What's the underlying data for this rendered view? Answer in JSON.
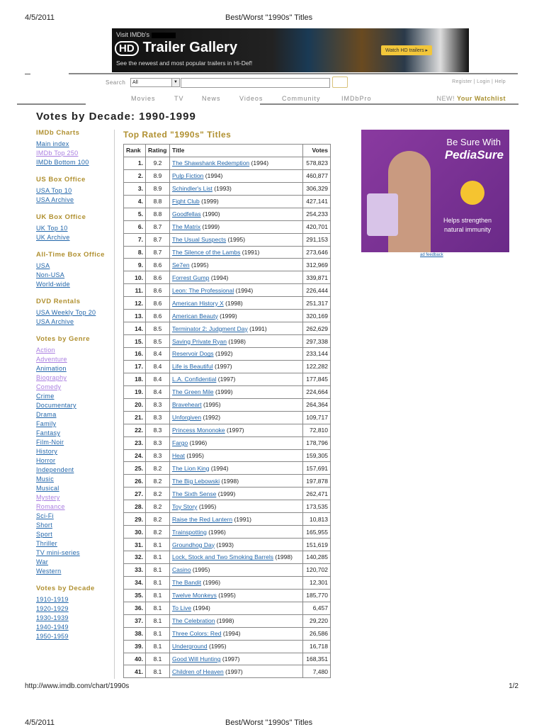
{
  "print_header": {
    "date": "4/5/2011",
    "title": "Best/Worst \"1990s\" Titles"
  },
  "banner": {
    "line1": "Visit IMDb's",
    "hd": "HD",
    "heading": "Trailer Gallery",
    "line3": "See the newest and most popular trailers in Hi-Def!",
    "watch": "Watch HD trailers ▸"
  },
  "search": {
    "label": "Search",
    "select": "All",
    "value": ""
  },
  "account": "Register | Login | Help",
  "nav": [
    "Movies",
    "TV",
    "News",
    "Videos",
    "Community",
    "IMDbPro"
  ],
  "watchlist": {
    "new": "NEW!",
    "label": "Your Watchlist"
  },
  "page_title": "Votes by Decade: 1990-1999",
  "sidebar": [
    {
      "heading": "IMDb Charts",
      "links": [
        {
          "t": "Main index"
        },
        {
          "t": "IMDb Top 250",
          "v": true
        },
        {
          "t": "IMDb Bottom 100"
        }
      ]
    },
    {
      "heading": "US Box Office",
      "links": [
        {
          "t": "USA Top 10"
        },
        {
          "t": "USA Archive"
        }
      ]
    },
    {
      "heading": "UK Box Office",
      "links": [
        {
          "t": "UK Top 10"
        },
        {
          "t": "UK Archive"
        }
      ]
    },
    {
      "heading": "All-Time Box Office",
      "links": [
        {
          "t": "USA"
        },
        {
          "t": "Non-USA"
        },
        {
          "t": "World-wide"
        }
      ]
    },
    {
      "heading": "DVD Rentals",
      "links": [
        {
          "t": "USA Weekly Top 20"
        },
        {
          "t": "USA Archive"
        }
      ]
    },
    {
      "heading": "Votes by Genre",
      "links": [
        {
          "t": "Action",
          "v": true
        },
        {
          "t": "Adventure",
          "v": true
        },
        {
          "t": "Animation"
        },
        {
          "t": "Biography",
          "v": true
        },
        {
          "t": "Comedy",
          "v": true
        },
        {
          "t": "Crime"
        },
        {
          "t": "Documentary"
        },
        {
          "t": "Drama"
        },
        {
          "t": "Family"
        },
        {
          "t": "Fantasy"
        },
        {
          "t": "Film-Noir"
        },
        {
          "t": "History"
        },
        {
          "t": "Horror"
        },
        {
          "t": "Independent"
        },
        {
          "t": "Music"
        },
        {
          "t": "Musical"
        },
        {
          "t": "Mystery",
          "v": true
        },
        {
          "t": "Romance",
          "v": true
        },
        {
          "t": "Sci-Fi"
        },
        {
          "t": "Short"
        },
        {
          "t": "Sport"
        },
        {
          "t": "Thriller"
        },
        {
          "t": "TV mini-series"
        },
        {
          "t": "War"
        },
        {
          "t": "Western"
        }
      ]
    },
    {
      "heading": "Votes by Decade",
      "links": [
        {
          "t": "1910-1919"
        },
        {
          "t": "1920-1929"
        },
        {
          "t": "1930-1939"
        },
        {
          "t": "1940-1949"
        },
        {
          "t": "1950-1959"
        }
      ]
    }
  ],
  "table": {
    "heading": "Top Rated \"1990s\" Titles",
    "columns": [
      "Rank",
      "Rating",
      "Title",
      "Votes"
    ],
    "rows": [
      [
        "1.",
        "9.2",
        "The Shawshank Redemption",
        "(1994)",
        "578,823"
      ],
      [
        "2.",
        "8.9",
        "Pulp Fiction",
        "(1994)",
        "460,877"
      ],
      [
        "3.",
        "8.9",
        "Schindler's List",
        "(1993)",
        "306,329"
      ],
      [
        "4.",
        "8.8",
        "Fight Club",
        "(1999)",
        "427,141"
      ],
      [
        "5.",
        "8.8",
        "Goodfellas",
        "(1990)",
        "254,233"
      ],
      [
        "6.",
        "8.7",
        "The Matrix",
        "(1999)",
        "420,701"
      ],
      [
        "7.",
        "8.7",
        "The Usual Suspects",
        "(1995)",
        "291,153"
      ],
      [
        "8.",
        "8.7",
        "The Silence of the Lambs",
        "(1991)",
        "273,646"
      ],
      [
        "9.",
        "8.6",
        "Se7en",
        "(1995)",
        "312,969"
      ],
      [
        "10.",
        "8.6",
        "Forrest Gump",
        "(1994)",
        "339,871"
      ],
      [
        "11.",
        "8.6",
        "Leon: The Professional",
        "(1994)",
        "226,444"
      ],
      [
        "12.",
        "8.6",
        "American History X",
        "(1998)",
        "251,317"
      ],
      [
        "13.",
        "8.6",
        "American Beauty",
        "(1999)",
        "320,169"
      ],
      [
        "14.",
        "8.5",
        "Terminator 2: Judgment Day",
        "(1991)",
        "262,629"
      ],
      [
        "15.",
        "8.5",
        "Saving Private Ryan",
        "(1998)",
        "297,338"
      ],
      [
        "16.",
        "8.4",
        "Reservoir Dogs",
        "(1992)",
        "233,144"
      ],
      [
        "17.",
        "8.4",
        "Life is Beautiful",
        "(1997)",
        "122,282"
      ],
      [
        "18.",
        "8.4",
        "L.A. Confidential",
        "(1997)",
        "177,845"
      ],
      [
        "19.",
        "8.4",
        "The Green Mile",
        "(1999)",
        "224,664"
      ],
      [
        "20.",
        "8.3",
        "Braveheart",
        "(1995)",
        "264,364"
      ],
      [
        "21.",
        "8.3",
        "Unforgiven",
        "(1992)",
        "109,717"
      ],
      [
        "22.",
        "8.3",
        "Princess Mononoke",
        "(1997)",
        "72,810"
      ],
      [
        "23.",
        "8.3",
        "Fargo",
        "(1996)",
        "178,796"
      ],
      [
        "24.",
        "8.3",
        "Heat",
        "(1995)",
        "159,305"
      ],
      [
        "25.",
        "8.2",
        "The Lion King",
        "(1994)",
        "157,691"
      ],
      [
        "26.",
        "8.2",
        "The Big Lebowski",
        "(1998)",
        "197,878"
      ],
      [
        "27.",
        "8.2",
        "The Sixth Sense",
        "(1999)",
        "262,471"
      ],
      [
        "28.",
        "8.2",
        "Toy Story",
        "(1995)",
        "173,535"
      ],
      [
        "29.",
        "8.2",
        "Raise the Red Lantern",
        "(1991)",
        "10,813"
      ],
      [
        "30.",
        "8.2",
        "Trainspotting",
        "(1996)",
        "165,955"
      ],
      [
        "31.",
        "8.1",
        "Groundhog Day",
        "(1993)",
        "151,619"
      ],
      [
        "32.",
        "8.1",
        "Lock, Stock and Two Smoking Barrels",
        "(1998)",
        "140,285"
      ],
      [
        "33.",
        "8.1",
        "Casino",
        "(1995)",
        "120,702"
      ],
      [
        "34.",
        "8.1",
        "The Bandit",
        "(1996)",
        "12,301"
      ],
      [
        "35.",
        "8.1",
        "Twelve Monkeys",
        "(1995)",
        "185,770"
      ],
      [
        "36.",
        "8.1",
        "To Live",
        "(1994)",
        "6,457"
      ],
      [
        "37.",
        "8.1",
        "The Celebration",
        "(1998)",
        "29,220"
      ],
      [
        "38.",
        "8.1",
        "Three Colors: Red",
        "(1994)",
        "26,586"
      ],
      [
        "39.",
        "8.1",
        "Underground",
        "(1995)",
        "16,718"
      ],
      [
        "40.",
        "8.1",
        "Good Will Hunting",
        "(1997)",
        "168,351"
      ],
      [
        "41.",
        "8.1",
        "Children of Heaven",
        "(1997)",
        "7,480"
      ]
    ]
  },
  "ad": {
    "line1": "Be Sure With",
    "brand": "PediaSure",
    "tagline": "Helps strengthen natural immunity",
    "feedback": "ad feedback"
  },
  "footer": {
    "url": "http://www.imdb.com/chart/1990s",
    "page": "1/2"
  },
  "print_header2": {
    "date": "4/5/2011",
    "title": "Best/Worst \"1990s\" Titles"
  }
}
